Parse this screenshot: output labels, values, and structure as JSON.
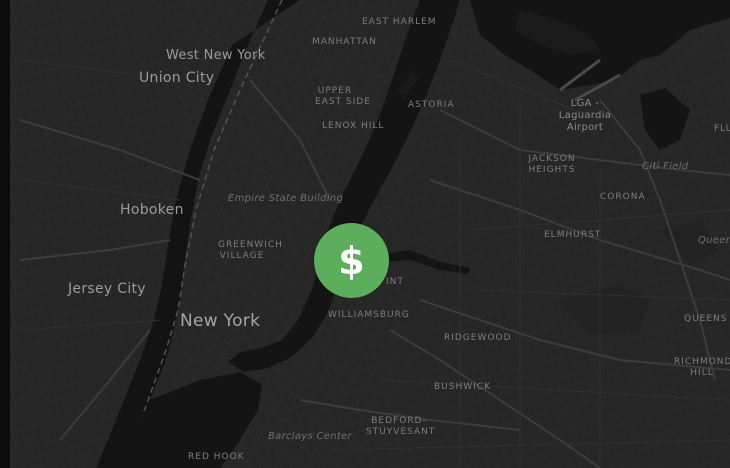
{
  "marker": {
    "glyph": "$",
    "icon": "dollar-icon",
    "color": "#5cae5c"
  },
  "labels": {
    "east_harlem": "EAST HARLEM",
    "manhattan": "MANHATTAN",
    "west_new_york": "West New York",
    "union_city": "Union City",
    "upper_east_side_1": "UPPER",
    "upper_east_side_2": "EAST SIDE",
    "lenox_hill": "LENOX HILL",
    "astoria": "ASTORIA",
    "lga_1": "LGA -",
    "lga_2": "Laguardia",
    "lga_3": "Airport",
    "flushing": "FLU",
    "jackson_heights_1": "JACKSON",
    "jackson_heights_2": "HEIGHTS",
    "citi_field": "Citi Field",
    "corona": "CORONA",
    "hoboken": "Hoboken",
    "empire_state": "Empire State Building",
    "greenwich_1": "GREENWICH",
    "greenwich_2": "VILLAGE",
    "elmhurst": "ELMHURST",
    "queens_italic": "Queens",
    "jersey_city": "Jersey City",
    "greenpoint": "INT",
    "new_york": "New York",
    "williamsburg": "WILLIAMSBURG",
    "ridgewood": "RIDGEWOOD",
    "queens": "QUEENS",
    "richmond_1": "RICHMOND",
    "richmond_2": "HILL",
    "bushwick": "BUSHWICK",
    "bedford_1": "BEDFORD-",
    "bedford_2": "STUYVESANT",
    "barclays": "Barclays Center",
    "red_hook": "RED HOOK"
  },
  "colors": {
    "land": "#262626",
    "water": "#131313",
    "road": "#3a3a3a",
    "marker": "#5cae5c"
  }
}
